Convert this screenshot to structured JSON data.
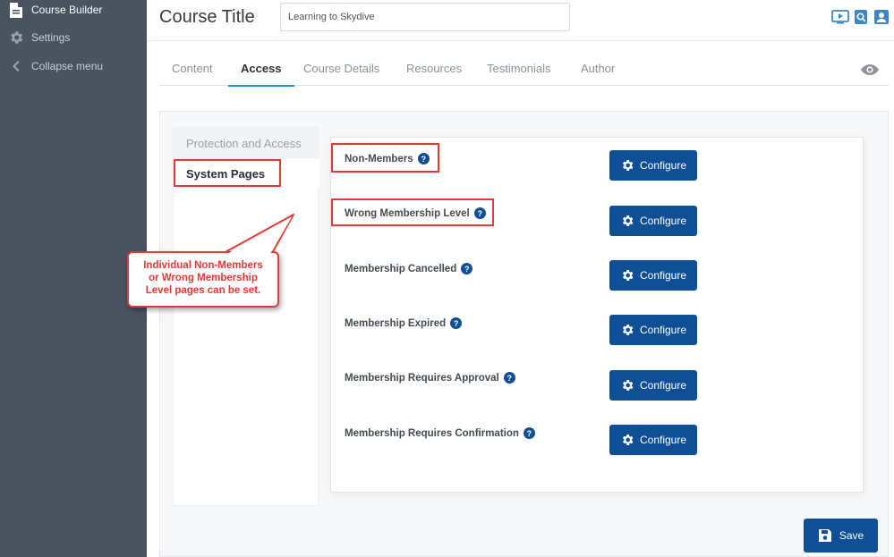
{
  "sidebar": {
    "items": [
      {
        "label": "Course Builder",
        "icon": "document-icon"
      },
      {
        "label": "Settings",
        "icon": "gear-icon"
      },
      {
        "label": "Collapse menu",
        "icon": "chevron-left-icon"
      }
    ]
  },
  "header": {
    "title": "Course Title",
    "course_name_value": "Learning to Skydive",
    "icons": [
      "video-icon",
      "search-doc-icon",
      "user-icon"
    ]
  },
  "tabs": [
    {
      "label": "Content"
    },
    {
      "label": "Access"
    },
    {
      "label": "Course Details"
    },
    {
      "label": "Resources"
    },
    {
      "label": "Testimonials"
    },
    {
      "label": "Author"
    }
  ],
  "subnav": {
    "items": [
      {
        "label": "Protection and Access"
      },
      {
        "label": "System Pages"
      }
    ]
  },
  "rows": [
    {
      "label": "Non-Members",
      "button": "Configure"
    },
    {
      "label": "Wrong Membership Level",
      "button": "Configure"
    },
    {
      "label": "Membership Cancelled",
      "button": "Configure"
    },
    {
      "label": "Membership Expired",
      "button": "Configure"
    },
    {
      "label": "Membership Requires Approval",
      "button": "Configure"
    },
    {
      "label": "Membership Requires Confirmation",
      "button": "Configure"
    }
  ],
  "help_glyph": "?",
  "callout": {
    "line1": "Individual Non-Members",
    "line2": "or Wrong Membership",
    "line3": "Level pages can be set."
  },
  "save_label": "Save",
  "colors": {
    "sidebar_bg": "#4a5360",
    "primary_button": "#0e4f96",
    "tab_underline": "#2a8fd8",
    "annotation_red": "#e53935"
  }
}
